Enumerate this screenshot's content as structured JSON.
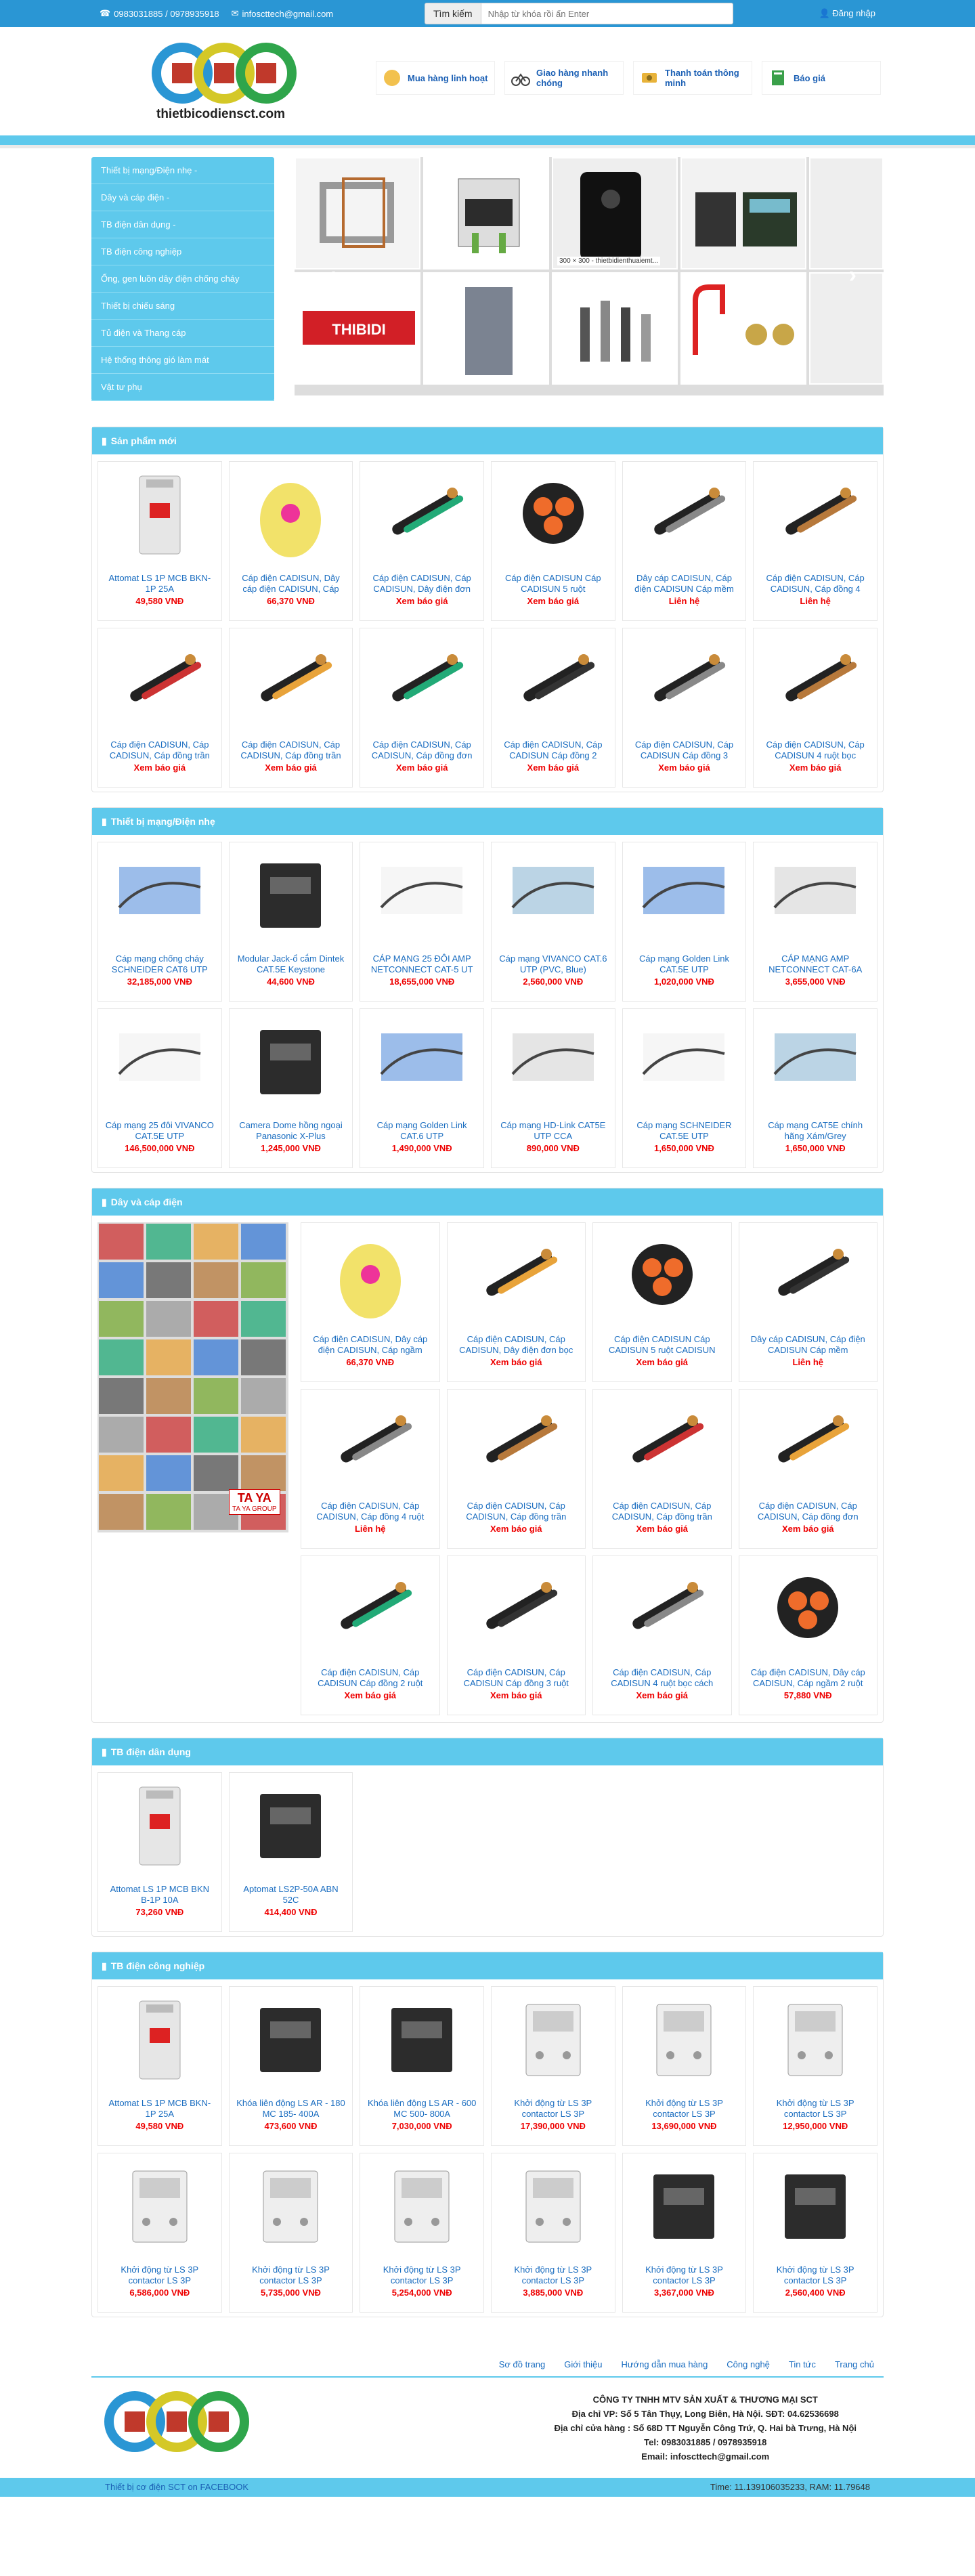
{
  "topbar": {
    "phone": "0983031885 / 0978935918",
    "email": "infoscttech@gmail.com",
    "search_label": "Tìm kiếm",
    "search_placeholder": "Nhập từ khóa rồi ấn Enter",
    "login": "Đăng nhập"
  },
  "logo_text": "thietbicodiensct.com",
  "features": [
    "Mua hàng linh hoạt",
    "Giao hàng nhanh chóng",
    "Thanh toán thông minh",
    "Báo giá"
  ],
  "sidebar": [
    "Thiết bị mạng/Điện nhẹ -",
    "Dây và cáp điện -",
    "TB điện dân dụng -",
    "TB điện công nghiệp",
    "Ống, gen luồn dây điện chống cháy",
    "Thiết bị chiếu sáng",
    "Tủ điện và Thang cáp",
    "Hệ thống thông gió làm mát",
    "Vật tư phụ"
  ],
  "slider_caption": "300 × 300 - thietbidienthuaiemt...",
  "slider_brand": "THIBIDI",
  "sections": {
    "new": {
      "title": "Sản phẩm mới",
      "items": [
        {
          "name": "Attomat LS 1P MCB BKN-1P 25A",
          "price": "49,580 VNĐ"
        },
        {
          "name": "Cáp điện CADISUN, Dây cáp điện CADISUN, Cáp",
          "price": "66,370 VNĐ"
        },
        {
          "name": "Cáp điện CADISUN, Cáp CADISUN, Dây điện đơn",
          "price": "Xem báo giá"
        },
        {
          "name": "Cáp điện CADISUN Cáp CADISUN 5 ruột",
          "price": "Xem báo giá"
        },
        {
          "name": "Dây cáp CADISUN, Cáp điện CADISUN Cáp mềm",
          "price": "Liên hệ"
        },
        {
          "name": "Cáp điện CADISUN, Cáp CADISUN, Cáp đồng 4",
          "price": "Liên hệ"
        },
        {
          "name": "Cáp điện CADISUN, Cáp CADISUN, Cáp đồng trần",
          "price": "Xem báo giá"
        },
        {
          "name": "Cáp điện CADISUN, Cáp CADISUN, Cáp đồng trần",
          "price": "Xem báo giá"
        },
        {
          "name": "Cáp điện CADISUN, Cáp CADISUN, Cáp đồng đơn",
          "price": "Xem báo giá"
        },
        {
          "name": "Cáp điện CADISUN, Cáp CADISUN Cáp đồng 2",
          "price": "Xem báo giá"
        },
        {
          "name": "Cáp điện CADISUN, Cáp CADISUN Cáp đồng 3",
          "price": "Xem báo giá"
        },
        {
          "name": "Cáp điện CADISUN, Cáp CADISUN 4 ruột bọc",
          "price": "Xem báo giá"
        }
      ]
    },
    "network": {
      "title": "Thiết bị mạng/Điện nhẹ",
      "items": [
        {
          "name": "Cáp mạng chống cháy SCHNEIDER CAT6 UTP",
          "price": "32,185,000 VNĐ"
        },
        {
          "name": "Modular Jack-ổ cắm Dintek CAT.5E Keystone",
          "price": "44,600 VNĐ"
        },
        {
          "name": "CÁP MẠNG 25 ĐÔI AMP NETCONNECT CAT-5 UT",
          "price": "18,655,000 VNĐ"
        },
        {
          "name": "Cáp mạng VIVANCO CAT.6 UTP (PVC, Blue)",
          "price": "2,560,000 VNĐ"
        },
        {
          "name": "Cáp mạng Golden Link CAT.5E UTP",
          "price": "1,020,000 VNĐ"
        },
        {
          "name": "CÁP MẠNG AMP NETCONNECT CAT-6A",
          "price": "3,655,000 VNĐ"
        },
        {
          "name": "Cáp mạng 25 đôi VIVANCO CAT.5E UTP",
          "price": "146,500,000 VNĐ"
        },
        {
          "name": "Camera Dome hồng ngoại Panasonic X-Plus",
          "price": "1,245,000 VNĐ"
        },
        {
          "name": "Cáp mạng Golden Link CAT.6 UTP",
          "price": "1,490,000 VNĐ"
        },
        {
          "name": "Cáp mạng HD-Link CAT5E UTP CCA",
          "price": "890,000 VNĐ"
        },
        {
          "name": "Cáp mạng SCHNEIDER CAT.5E UTP",
          "price": "1,650,000 VNĐ"
        },
        {
          "name": "Cáp mạng CAT5E chính hãng Xám/Grey",
          "price": "1,650,000 VNĐ"
        }
      ]
    },
    "cable": {
      "title": "Dây và cáp điện",
      "banner_brand": "TA YA",
      "banner_brand_sub": "TA YA GROUP",
      "items": [
        {
          "name": "Cáp điện CADISUN, Dây cáp điện CADISUN, Cáp ngầm",
          "price": "66,370 VNĐ"
        },
        {
          "name": "Cáp điện CADISUN, Cáp CADISUN, Dây điện đơn bọc",
          "price": "Xem báo giá"
        },
        {
          "name": "Cáp điện CADISUN Cáp CADISUN 5 ruột CADISUN",
          "price": "Xem báo giá"
        },
        {
          "name": "Dây cáp CADISUN, Cáp điện CADISUN Cáp mềm",
          "price": "Liên hệ"
        },
        {
          "name": "Cáp điện CADISUN, Cáp CADISUN, Cáp đồng 4 ruột",
          "price": "Liên hệ"
        },
        {
          "name": "Cáp điện CADISUN, Cáp CADISUN, Cáp đồng trần",
          "price": "Xem báo giá"
        },
        {
          "name": "Cáp điện CADISUN, Cáp CADISUN, Cáp đồng trần",
          "price": "Xem báo giá"
        },
        {
          "name": "Cáp điện CADISUN, Cáp CADISUN, Cáp đồng đơn",
          "price": "Xem báo giá"
        },
        {
          "name": "Cáp điện CADISUN, Cáp CADISUN Cáp đồng 2 ruột",
          "price": "Xem báo giá"
        },
        {
          "name": "Cáp điện CADISUN, Cáp CADISUN Cáp đồng 3 ruột",
          "price": "Xem báo giá"
        },
        {
          "name": "Cáp điện CADISUN, Cáp CADISUN 4 ruột bọc cách",
          "price": "Xem báo giá"
        },
        {
          "name": "Cáp điện CADISUN, Dây cáp CADISUN, Cáp ngầm 2 ruột",
          "price": "57,880 VNĐ"
        }
      ]
    },
    "home": {
      "title": "TB điện dân dụng",
      "items": [
        {
          "name": "Attomat LS 1P MCB BKN B-1P 10A",
          "price": "73,260 VNĐ"
        },
        {
          "name": "Aptomat LS2P-50A ABN 52C",
          "price": "414,400 VNĐ"
        }
      ]
    },
    "industrial": {
      "title": "TB điện công nghiệp",
      "items": [
        {
          "name": "Attomat LS 1P MCB BKN-1P 25A",
          "price": "49,580 VNĐ"
        },
        {
          "name": "Khóa liên động LS AR - 180 MC 185- 400A",
          "price": "473,600 VNĐ"
        },
        {
          "name": "Khóa liên động LS AR - 600 MC 500- 800A",
          "price": "7,030,000 VNĐ"
        },
        {
          "name": "Khởi động từ LS 3P contactor LS 3P",
          "price": "17,390,000 VNĐ"
        },
        {
          "name": "Khởi động từ LS 3P contactor LS 3P",
          "price": "13,690,000 VNĐ"
        },
        {
          "name": "Khởi động từ LS 3P contactor LS 3P",
          "price": "12,950,000 VNĐ"
        },
        {
          "name": "Khởi động từ LS 3P contactor LS 3P",
          "price": "6,586,000 VNĐ"
        },
        {
          "name": "Khởi động từ LS 3P contactor LS 3P",
          "price": "5,735,000 VNĐ"
        },
        {
          "name": "Khởi động từ LS 3P contactor LS 3P",
          "price": "5,254,000 VNĐ"
        },
        {
          "name": "Khởi động từ LS 3P contactor LS 3P",
          "price": "3,885,000 VNĐ"
        },
        {
          "name": "Khởi động từ LS 3P contactor LS 3P",
          "price": "3,367,000 VNĐ"
        },
        {
          "name": "Khởi động từ LS 3P contactor LS 3P",
          "price": "2,560,400 VNĐ"
        }
      ]
    }
  },
  "footer_links": [
    "Sơ đồ trang",
    "Giới thiệu",
    "Hướng dẫn mua hàng",
    "Công nghệ",
    "Tin tức",
    "Trang chủ"
  ],
  "footer": {
    "company": "CÔNG TY TNHH MTV SẢN XUẤT & THƯƠNG MẠI SCT",
    "office": "Địa chỉ VP: Số 5 Tân Thụy, Long Biên, Hà Nội. SĐT: 04.62536698",
    "store": "Địa chỉ cửa hàng : Số 68D TT Nguyễn Công Trứ, Q. Hai bà Trưng, Hà Nội",
    "tel": "Tel: 0983031885 / 0978935918",
    "email": "Email: infoscttech@gmail.com"
  },
  "bottombar": {
    "facebook": "Thiết bị cơ điện SCT on FACEBOOK",
    "time": "Time: 11.1391060352​33, RAM: 11.79648"
  },
  "colors": {
    "topbar": "#2a96d4",
    "accent": "#5ec9ec",
    "price": "#ee0000",
    "link": "#1a6dc0"
  }
}
